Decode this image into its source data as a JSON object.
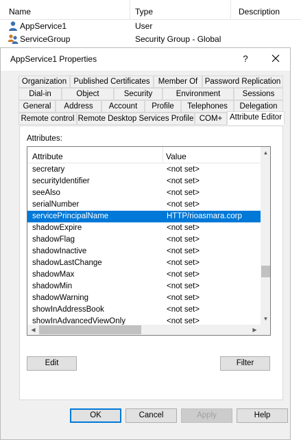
{
  "list": {
    "columns": [
      "Name",
      "Type",
      "Description"
    ],
    "rows": [
      {
        "name": "AppService1",
        "type": "User",
        "icon": "user-icon"
      },
      {
        "name": "ServiceGroup",
        "type": "Security Group - Global",
        "icon": "group-icon"
      }
    ]
  },
  "dialog": {
    "title": "AppService1 Properties",
    "help_label": "?",
    "tabs_row1": [
      "Organization",
      "Published Certificates",
      "Member Of",
      "Password Replication"
    ],
    "tabs_row2": [
      "Dial-in",
      "Object",
      "Security",
      "Environment",
      "Sessions"
    ],
    "tabs_row3": [
      "General",
      "Address",
      "Account",
      "Profile",
      "Telephones",
      "Delegation"
    ],
    "tabs_row4": [
      "Remote control",
      "Remote Desktop Services Profile",
      "COM+",
      "Attribute Editor"
    ],
    "active_tab": "Attribute Editor",
    "attributes_label": "Attributes:",
    "attr_columns": [
      "Attribute",
      "Value"
    ],
    "attributes": [
      {
        "name": "secretary",
        "value": "<not set>"
      },
      {
        "name": "securityIdentifier",
        "value": "<not set>"
      },
      {
        "name": "seeAlso",
        "value": "<not set>"
      },
      {
        "name": "serialNumber",
        "value": "<not set>"
      },
      {
        "name": "servicePrincipalName",
        "value": "HTTP/rioasmara.corp",
        "selected": true
      },
      {
        "name": "shadowExpire",
        "value": "<not set>"
      },
      {
        "name": "shadowFlag",
        "value": "<not set>"
      },
      {
        "name": "shadowInactive",
        "value": "<not set>"
      },
      {
        "name": "shadowLastChange",
        "value": "<not set>"
      },
      {
        "name": "shadowMax",
        "value": "<not set>"
      },
      {
        "name": "shadowMin",
        "value": "<not set>"
      },
      {
        "name": "shadowWarning",
        "value": "<not set>"
      },
      {
        "name": "showInAddressBook",
        "value": "<not set>"
      },
      {
        "name": "showInAdvancedViewOnly",
        "value": "<not set>"
      }
    ],
    "buttons": {
      "edit": "Edit",
      "filter": "Filter",
      "ok": "OK",
      "cancel": "Cancel",
      "apply": "Apply",
      "help": "Help"
    },
    "colors": {
      "selection": "#0078d7",
      "dialog_bg": "#f0f0f0"
    }
  }
}
